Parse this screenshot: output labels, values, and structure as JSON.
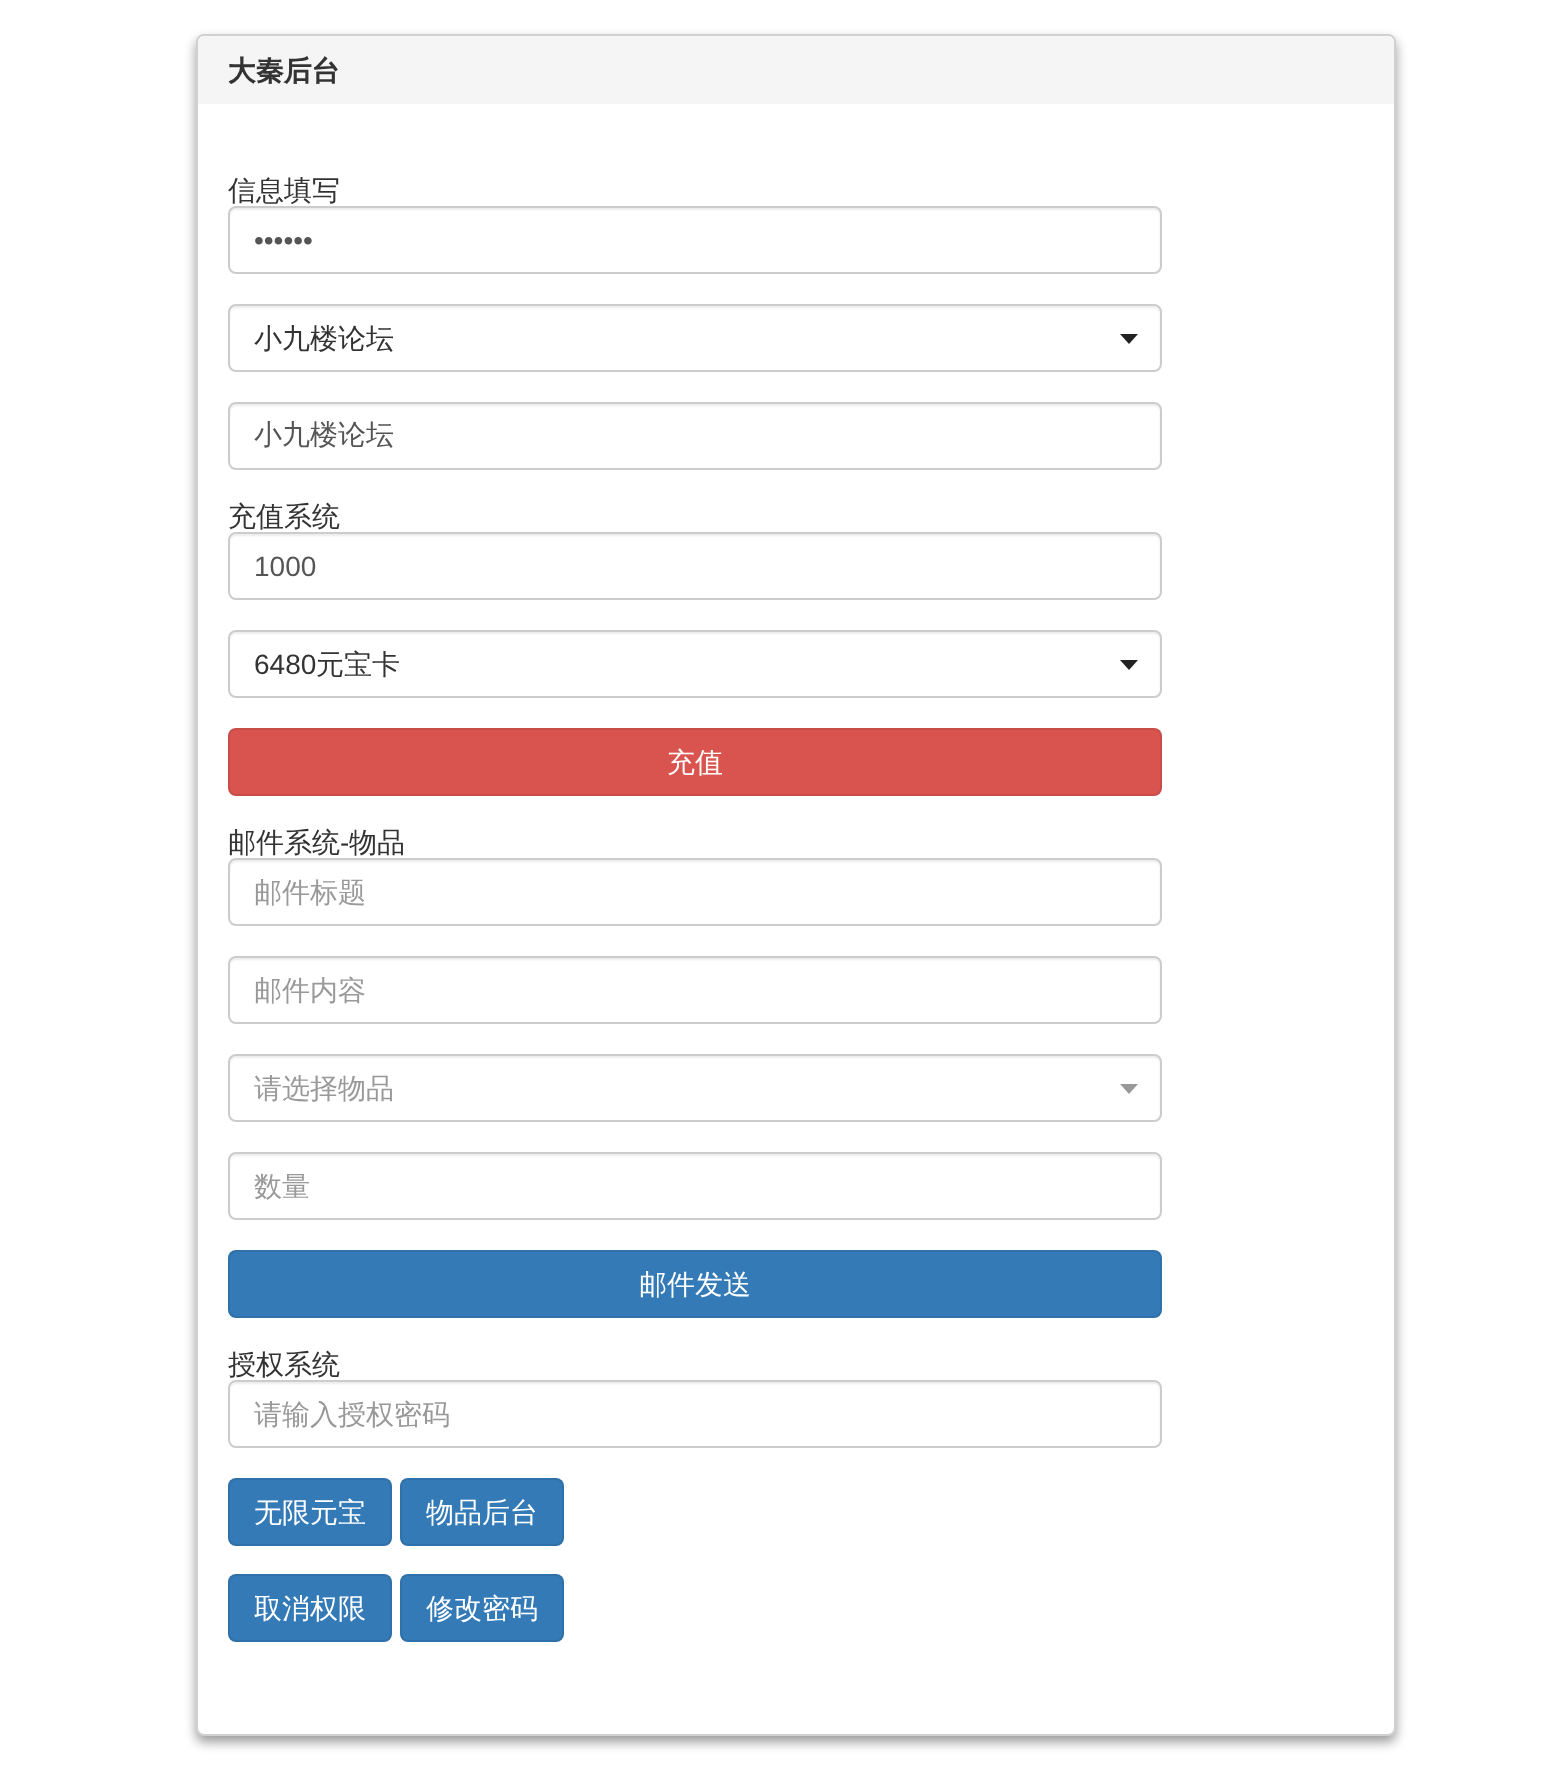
{
  "panel": {
    "title": "大秦后台"
  },
  "sections": [
    {
      "label": "信息填写",
      "items": [
        {
          "kind": "password",
          "value": "••••••"
        },
        {
          "kind": "select",
          "value": "小九楼论坛"
        },
        {
          "kind": "text",
          "value": "小九楼论坛"
        }
      ]
    },
    {
      "label": "充值系统",
      "items": [
        {
          "kind": "text",
          "value": "1000"
        },
        {
          "kind": "select",
          "value": "6480元宝卡"
        },
        {
          "kind": "button",
          "label": "充值",
          "color": "#d9534f"
        }
      ]
    },
    {
      "label": "邮件系统-物品",
      "items": [
        {
          "kind": "text",
          "placeholder": "邮件标题"
        },
        {
          "kind": "text",
          "placeholder": "邮件内容"
        },
        {
          "kind": "select",
          "placeholder": "请选择物品"
        },
        {
          "kind": "text",
          "placeholder": "数量"
        },
        {
          "kind": "button",
          "label": "邮件发送",
          "color": "#337ab7"
        }
      ]
    },
    {
      "label": "授权系统",
      "items": [
        {
          "kind": "text",
          "placeholder": "请输入授权密码"
        }
      ],
      "button_rows": [
        [
          {
            "label": "无限元宝"
          },
          {
            "label": "物品后台"
          }
        ],
        [
          {
            "label": "取消权限"
          },
          {
            "label": "修改密码"
          }
        ]
      ]
    }
  ]
}
